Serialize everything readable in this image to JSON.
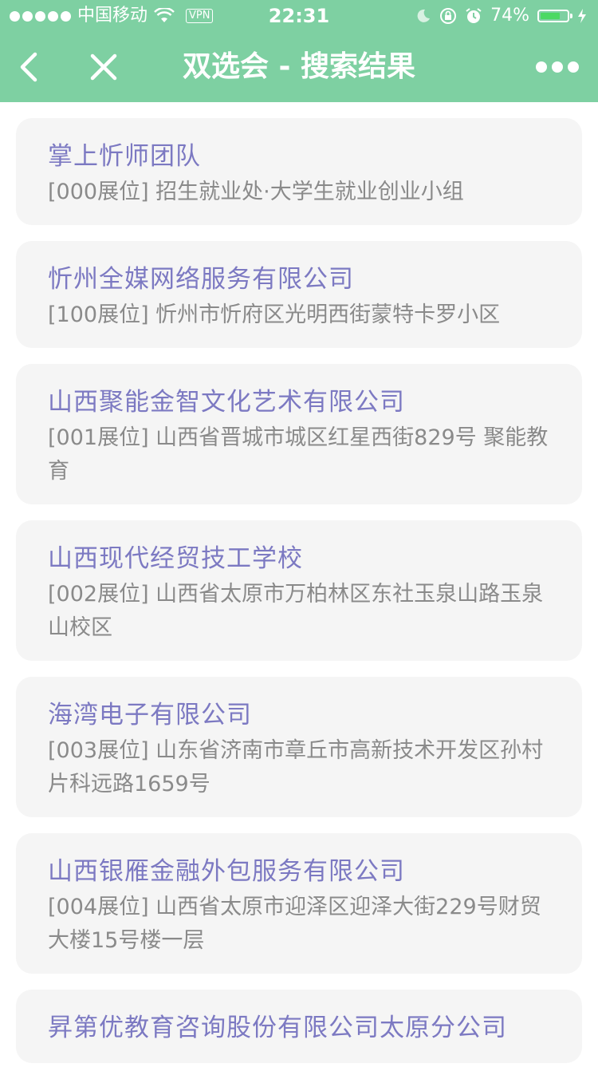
{
  "status_bar": {
    "carrier": "中国移动",
    "vpn": "VPN",
    "time": "22:31",
    "battery": "74%",
    "battery_level": 0.74
  },
  "nav": {
    "title": "双选会 - 搜索结果"
  },
  "results": [
    {
      "name": "掌上忻师团队",
      "address": "[000展位] 招生就业处·大学生就业创业小组"
    },
    {
      "name": "忻州全媒网络服务有限公司",
      "address": "[100展位] 忻州市忻府区光明西街蒙特卡罗小区"
    },
    {
      "name": "山西聚能金智文化艺术有限公司",
      "address": "[001展位] 山西省晋城市城区红星西街829号 聚能教育"
    },
    {
      "name": "山西现代经贸技工学校",
      "address": "[002展位] 山西省太原市万柏林区东社玉泉山路玉泉山校区"
    },
    {
      "name": "海湾电子有限公司",
      "address": "[003展位] 山东省济南市章丘市高新技术开发区孙村片科远路1659号"
    },
    {
      "name": "山西银雁金融外包服务有限公司",
      "address": "[004展位] 山西省太原市迎泽区迎泽大街229号财贸大楼15号楼一层"
    },
    {
      "name": "昇第优教育咨询股份有限公司太原分公司",
      "address": ""
    }
  ]
}
